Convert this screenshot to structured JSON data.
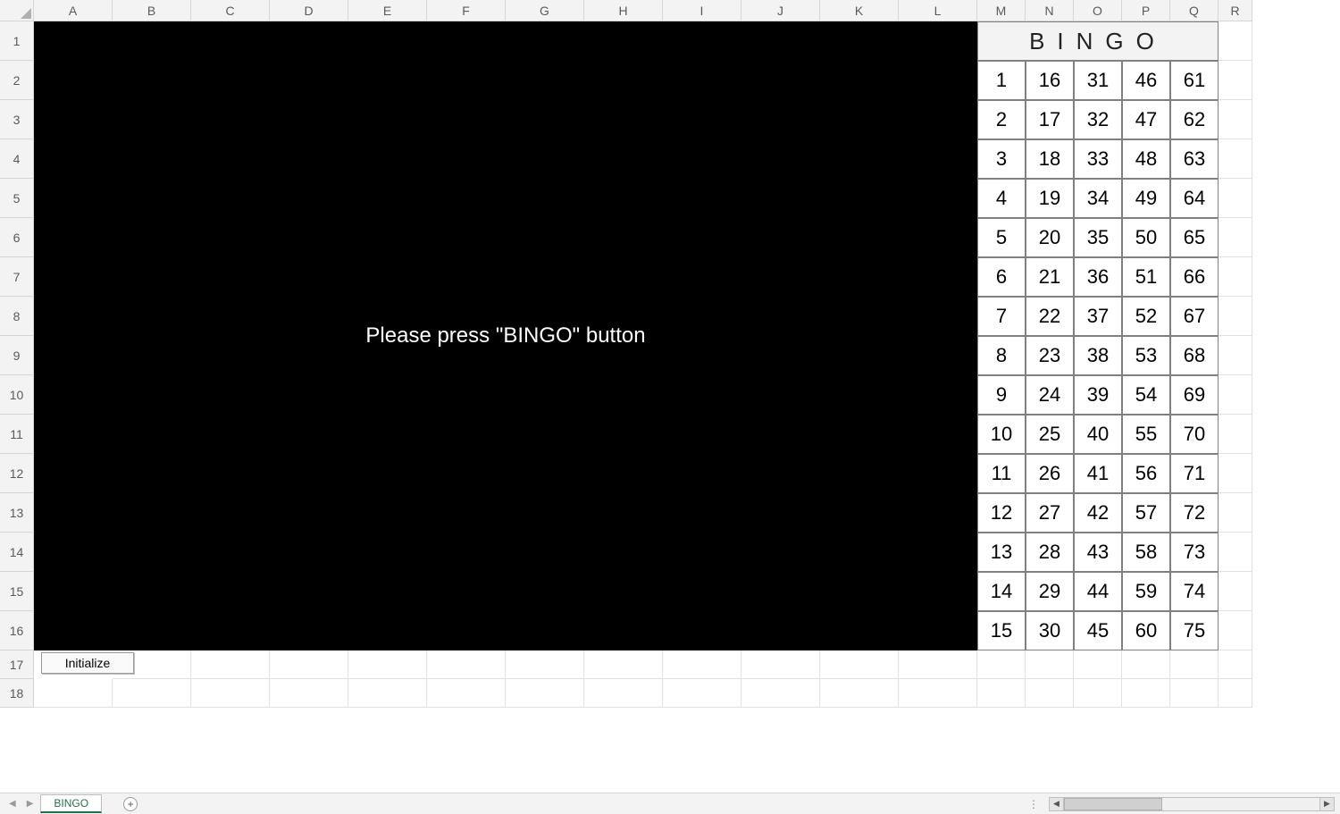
{
  "columns": [
    "A",
    "B",
    "C",
    "D",
    "E",
    "F",
    "G",
    "H",
    "I",
    "J",
    "K",
    "L",
    "M",
    "N",
    "O",
    "P",
    "Q",
    "R"
  ],
  "rows": [
    1,
    2,
    3,
    4,
    5,
    6,
    7,
    8,
    9,
    10,
    11,
    12,
    13,
    14,
    15,
    16,
    17,
    18
  ],
  "panel_message": "Please press \"BINGO\" button",
  "bingo_header": "BINGO",
  "bingo_board": {
    "cols": 5,
    "rows": 15,
    "values": [
      [
        1,
        16,
        31,
        46,
        61
      ],
      [
        2,
        17,
        32,
        47,
        62
      ],
      [
        3,
        18,
        33,
        48,
        63
      ],
      [
        4,
        19,
        34,
        49,
        64
      ],
      [
        5,
        20,
        35,
        50,
        65
      ],
      [
        6,
        21,
        36,
        51,
        66
      ],
      [
        7,
        22,
        37,
        52,
        67
      ],
      [
        8,
        23,
        38,
        53,
        68
      ],
      [
        9,
        24,
        39,
        54,
        69
      ],
      [
        10,
        25,
        40,
        55,
        70
      ],
      [
        11,
        26,
        41,
        56,
        71
      ],
      [
        12,
        27,
        42,
        57,
        72
      ],
      [
        13,
        28,
        43,
        58,
        73
      ],
      [
        14,
        29,
        44,
        59,
        74
      ],
      [
        15,
        30,
        45,
        60,
        75
      ]
    ]
  },
  "initialize_button": "Initialize",
  "sheet_tab_name": "BINGO",
  "add_sheet_glyph": "+"
}
